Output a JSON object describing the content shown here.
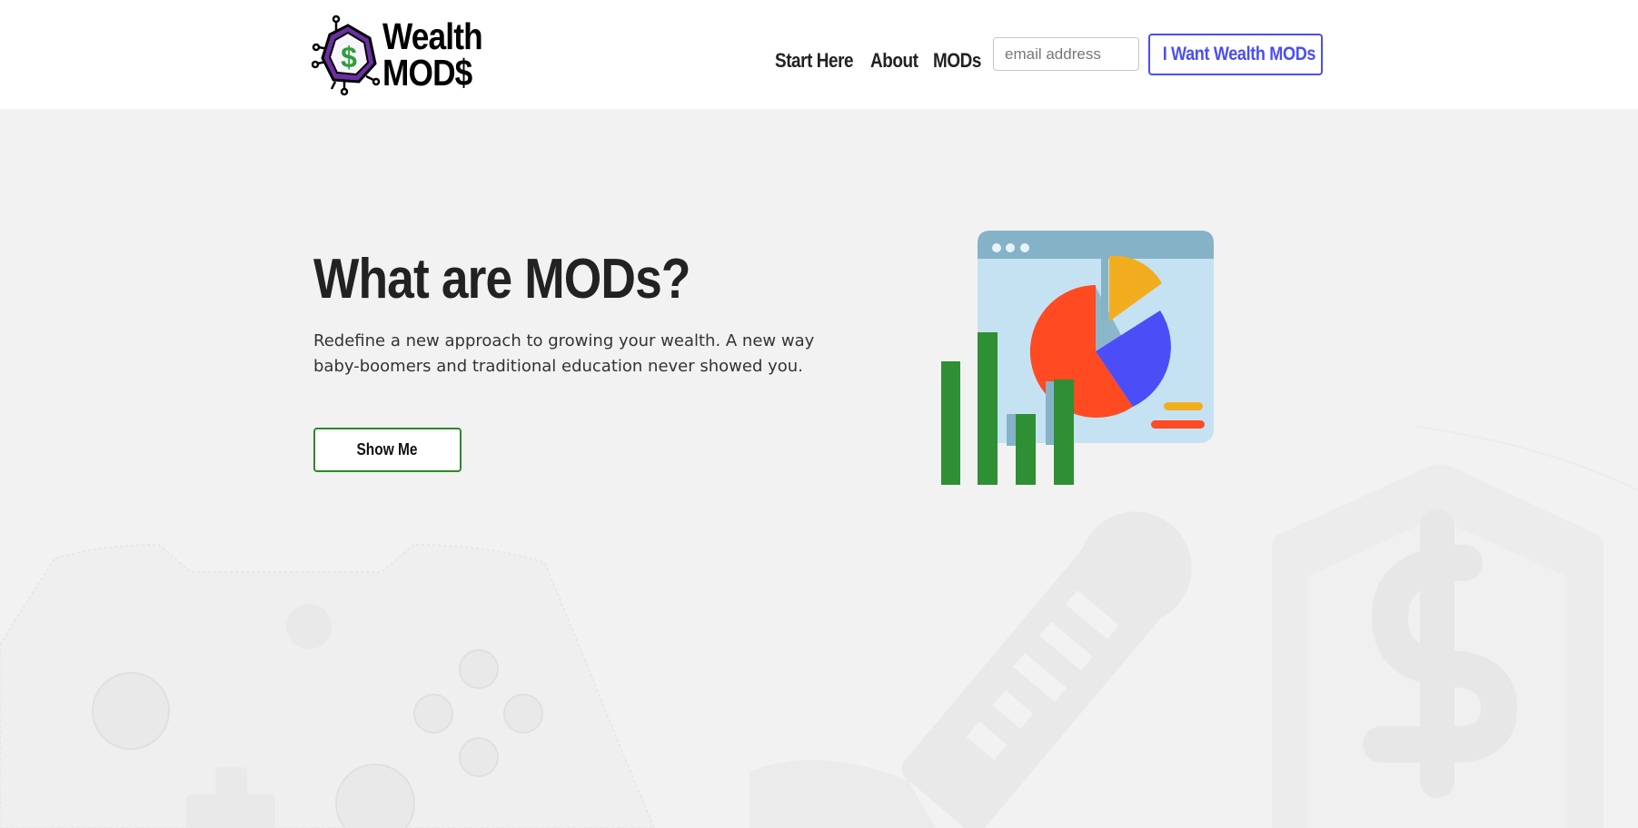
{
  "brand": {
    "line1": "Wealth",
    "line2": "MOD$",
    "logo_icon": "dollar-chip-icon",
    "accent_green": "#2e9e3a",
    "accent_purple": "#6a2fa0"
  },
  "nav": {
    "items": [
      {
        "label": "Start Here"
      },
      {
        "label": "About"
      },
      {
        "label": "MODs"
      }
    ],
    "email_placeholder": "email address",
    "cta_label": "I Want Wealth MODs",
    "cta_color": "#4a4ef2"
  },
  "hero": {
    "title": "What are MODs?",
    "description": "Redefine a new approach to growing your wealth. A new way baby-boomers and traditional education never showed you.",
    "button_label": "Show Me",
    "button_color": "#2a8a2a"
  },
  "illustration": {
    "name": "finance-dashboard-illustration",
    "colors": {
      "window": "#c5e2f2",
      "titlebar": "#85b2c7",
      "pie_red": "#ff4a22",
      "pie_blue": "#4b4ef7",
      "pie_yellow": "#f2ad1e",
      "bars": "#2f8f35"
    }
  },
  "background_icons": [
    "game-controller-icon",
    "microphone-icon",
    "shield-dollar-icon"
  ]
}
